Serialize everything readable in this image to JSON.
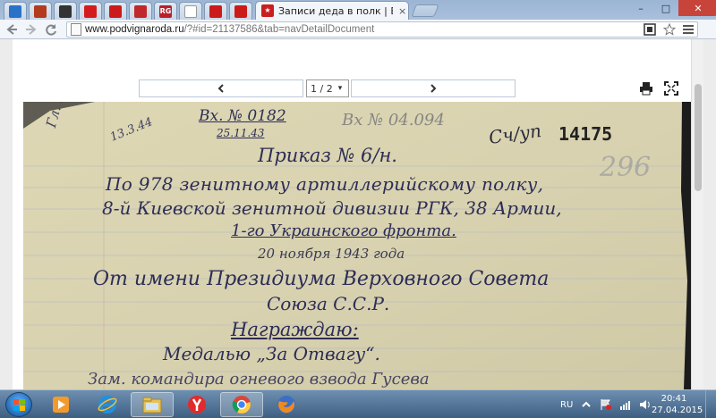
{
  "browser": {
    "active_tab_title": "Записи деда в полк | Бе:",
    "close_glyph": "×",
    "pinned_tabs": [
      {
        "icon": "home-icon",
        "label": "",
        "color": "#2a72c7"
      },
      {
        "icon": "record-icon",
        "label": "",
        "color": "#b43a1e"
      },
      {
        "icon": "film-icon",
        "label": "",
        "color": "#333333"
      },
      {
        "icon": "star-icon",
        "label": "",
        "color": "#d41c1c"
      },
      {
        "icon": "red-emblem-icon",
        "label": "",
        "color": "#cc1a1a"
      },
      {
        "icon": "star-outline-icon",
        "label": "",
        "color": "#c0282b"
      },
      {
        "icon": "rg-ru-icon",
        "label": "RG",
        "color": "#b8202a"
      },
      {
        "icon": "blank-page-icon",
        "label": "",
        "color": "#ffffff"
      },
      {
        "icon": "red-emblem-icon",
        "label": "",
        "color": "#cc1a1a"
      },
      {
        "icon": "red-emblem-icon",
        "label": "",
        "color": "#cc1a1a"
      }
    ],
    "window_controls": {
      "minimize": "–",
      "maximize": "□",
      "close": "✕"
    }
  },
  "address_bar": {
    "host": "www.podvignaroda.ru",
    "path": "/?#id=21137586&tab=navDetailDocument"
  },
  "viewer": {
    "prev_glyph": "◀",
    "next_glyph": "▶",
    "page_value": "1 / 2",
    "dropdown_glyph": "▾"
  },
  "document": {
    "corner_note": "Гл. Упр. ф",
    "corner_date": "13.3.44",
    "ref_top": "Вх. № 0182",
    "ref_date": "25.11.43",
    "stamp_ref": "Вх № 04.094",
    "secret_mark": "Сч/уп",
    "archive_number": "14175",
    "page_mark": "296",
    "line1": "Приказ № 6/н.",
    "line2": "По 978 зенитному артиллерийскому полку,",
    "line3": "8-й Киевской зенитной дивизии РГК, 38 Армии,",
    "line4": "1-го Украинского фронта.",
    "line5": "20 ноября 1943 года",
    "line6": "От имени Президиума Верховного Совета",
    "line7": "Союза С.С.Р.",
    "line8": "Награждаю:",
    "line9": "Медалью „За Отвагу“.",
    "line10": "Зам. командира огневого взвода Гусева"
  },
  "taskbar": {
    "apps": [
      {
        "icon": "media-player-icon"
      },
      {
        "icon": "internet-explorer-icon"
      },
      {
        "icon": "file-explorer-icon"
      },
      {
        "icon": "yandex-browser-icon"
      },
      {
        "icon": "chrome-icon"
      },
      {
        "icon": "firefox-icon"
      }
    ],
    "language": "RU",
    "time": "20:41",
    "date": "27.04.2015"
  }
}
